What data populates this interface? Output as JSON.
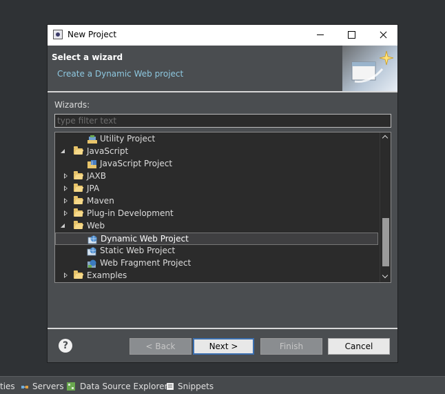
{
  "window": {
    "title": "New Project"
  },
  "header": {
    "title": "Select a wizard",
    "subtitle": "Create a Dynamic Web project"
  },
  "filter": {
    "label": "Wizards:",
    "placeholder": "type filter text",
    "value": ""
  },
  "tree": {
    "items": [
      {
        "label": "Utility Project",
        "level": 2,
        "type": "project-icon",
        "state": "leaf"
      },
      {
        "label": "JavaScript",
        "level": 1,
        "type": "folder-icon",
        "state": "expanded"
      },
      {
        "label": "JavaScript Project",
        "level": 2,
        "type": "javascript-project-icon",
        "state": "leaf"
      },
      {
        "label": "JAXB",
        "level": 1,
        "type": "folder-icon",
        "state": "collapsed"
      },
      {
        "label": "JPA",
        "level": 1,
        "type": "folder-icon",
        "state": "collapsed"
      },
      {
        "label": "Maven",
        "level": 1,
        "type": "folder-icon",
        "state": "collapsed"
      },
      {
        "label": "Plug-in Development",
        "level": 1,
        "type": "folder-icon",
        "state": "collapsed"
      },
      {
        "label": "Web",
        "level": 1,
        "type": "folder-icon",
        "state": "expanded"
      },
      {
        "label": "Dynamic Web Project",
        "level": 2,
        "type": "web-project-icon",
        "state": "leaf",
        "selected": true
      },
      {
        "label": "Static Web Project",
        "level": 2,
        "type": "web-project-icon",
        "state": "leaf"
      },
      {
        "label": "Web Fragment Project",
        "level": 2,
        "type": "web-fragment-icon",
        "state": "leaf"
      },
      {
        "label": "Examples",
        "level": 1,
        "type": "folder-icon",
        "state": "collapsed"
      }
    ]
  },
  "buttons": {
    "help": "?",
    "back": "< Back",
    "next": "Next >",
    "finish": "Finish",
    "cancel": "Cancel"
  },
  "statusbar": {
    "tabs": [
      "ties",
      "Servers",
      "Data Source Explorer",
      "Snippets"
    ]
  },
  "colors": {
    "dialog_bg": "#4a4d50",
    "tree_bg": "#2b2b2b",
    "subtitle": "#8ec8e0",
    "default_button_border": "#3b6fb0"
  }
}
